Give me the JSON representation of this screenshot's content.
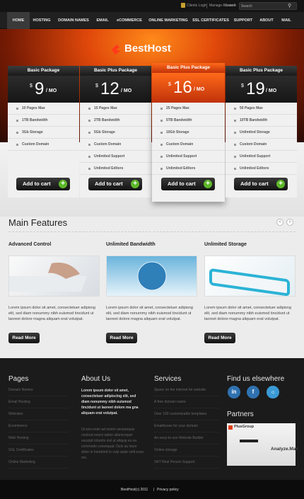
{
  "topbar": {
    "client_login": "Clients Login",
    "manage_account": "Manage Account",
    "search_label": "Search"
  },
  "nav": [
    "HOME",
    "HOSTING",
    "DOMAIN NAMES",
    "EMAIL",
    "eCOMMERCE",
    "ONLINE MARKETING",
    "SSL CERTIFICATES",
    "SUPPORT",
    "ABOUT",
    "MAIL"
  ],
  "logo": "BestHost",
  "plans": [
    {
      "name": "Basic Package",
      "price": "9",
      "per": "/ MO",
      "features": [
        "10 Pages Max",
        "1TB Bandwidth",
        "3Gb Storage",
        "Custom Domain"
      ],
      "cart": "Add to cart"
    },
    {
      "name": "Basic Plus Package",
      "price": "12",
      "per": "/ MO",
      "features": [
        "15 Pages Max",
        "2TB Bandwidth",
        "5Gb Storage",
        "Custom Domain",
        "Unlimited Support",
        "Unlimited Editors"
      ],
      "cart": "Add to cart"
    },
    {
      "name": "Basic Plus Package",
      "price": "16",
      "per": "/ MO",
      "features": [
        "25 Pages Max",
        "5TB Bandwidth",
        "10Gb Storage",
        "Custom Domain",
        "Unlimited Support",
        "Unlimited Editors"
      ],
      "cart": "Add to cart"
    },
    {
      "name": "Basic Plus Package",
      "price": "19",
      "per": "/ MO",
      "features": [
        "50 Pages Max",
        "10TB Bandwidth",
        "Unlimited Storage",
        "Custom Domain",
        "Unlimited Support",
        "Unlimited Editors"
      ],
      "cart": "Add to cart"
    }
  ],
  "main_title": "Main Features",
  "features": [
    {
      "title": "Advanced Control",
      "text": "Lorem ipsum dolor sit amet, consectetuer adipisng elit, sed diam nonummy nibh euismod tincidunt ut laoreet dolore magna aliquam erat volutpat.",
      "button": "Read More"
    },
    {
      "title": "Unlimited Bandwidth",
      "text": "Lorem ipsum dolor sit amet, consectetuer adipisng elit, sed diam nonummy nibh euismod tincidunt ut laoreet dolore magna aliquam erat volutpat.",
      "button": "Read More"
    },
    {
      "title": "Unlimited Storage",
      "text": "Lorem ipsum dolor sit amet, consectetuer adipisng elit, sed diam nonummy nibh euismod tincidunt ut laoreet dolore magna aliquam erat volutpat.",
      "button": "Read More"
    }
  ],
  "footer": {
    "pages_title": "Pages",
    "pages": [
      "Domain Names",
      "Email Hosting",
      "Websites",
      "Ecommerce",
      "Web Hosting",
      "SSL Certificates",
      "Online Marketing"
    ],
    "about_title": "About Us",
    "about_bold": "Lorem ipsum dolor sit amet, consectetuer adipiscing elit, sed diam nonummy nibh euismod tincidunt ut laoreet dolore ma gna aliquam erat volutpat.",
    "about_text": "Ut wisi enim ad minim veniamquis nostrud exerci tation ullamcorper suscipit lobortis nisl ut aliquip ex ea commodo consequat. Duis au iriure dolor in hendrerit in vulp utate velit esse mo.",
    "services_title": "Services",
    "services": [
      "Space on the internet for website",
      "A free domain name",
      "Over 100 customizable templates",
      "Emailboxes for your domain",
      "An easy-to-use Website Builder",
      "Online storage",
      "24/7 Real Person Support"
    ],
    "find_title": "Find us elsewhere",
    "partners_title": "Partners",
    "partner_name": "PlusGroup",
    "partner_tagline": "Analyze.Mak"
  },
  "bottom": {
    "copyright": "BestHost(c) 2011",
    "sep": "|",
    "privacy": "Privacy policy"
  }
}
